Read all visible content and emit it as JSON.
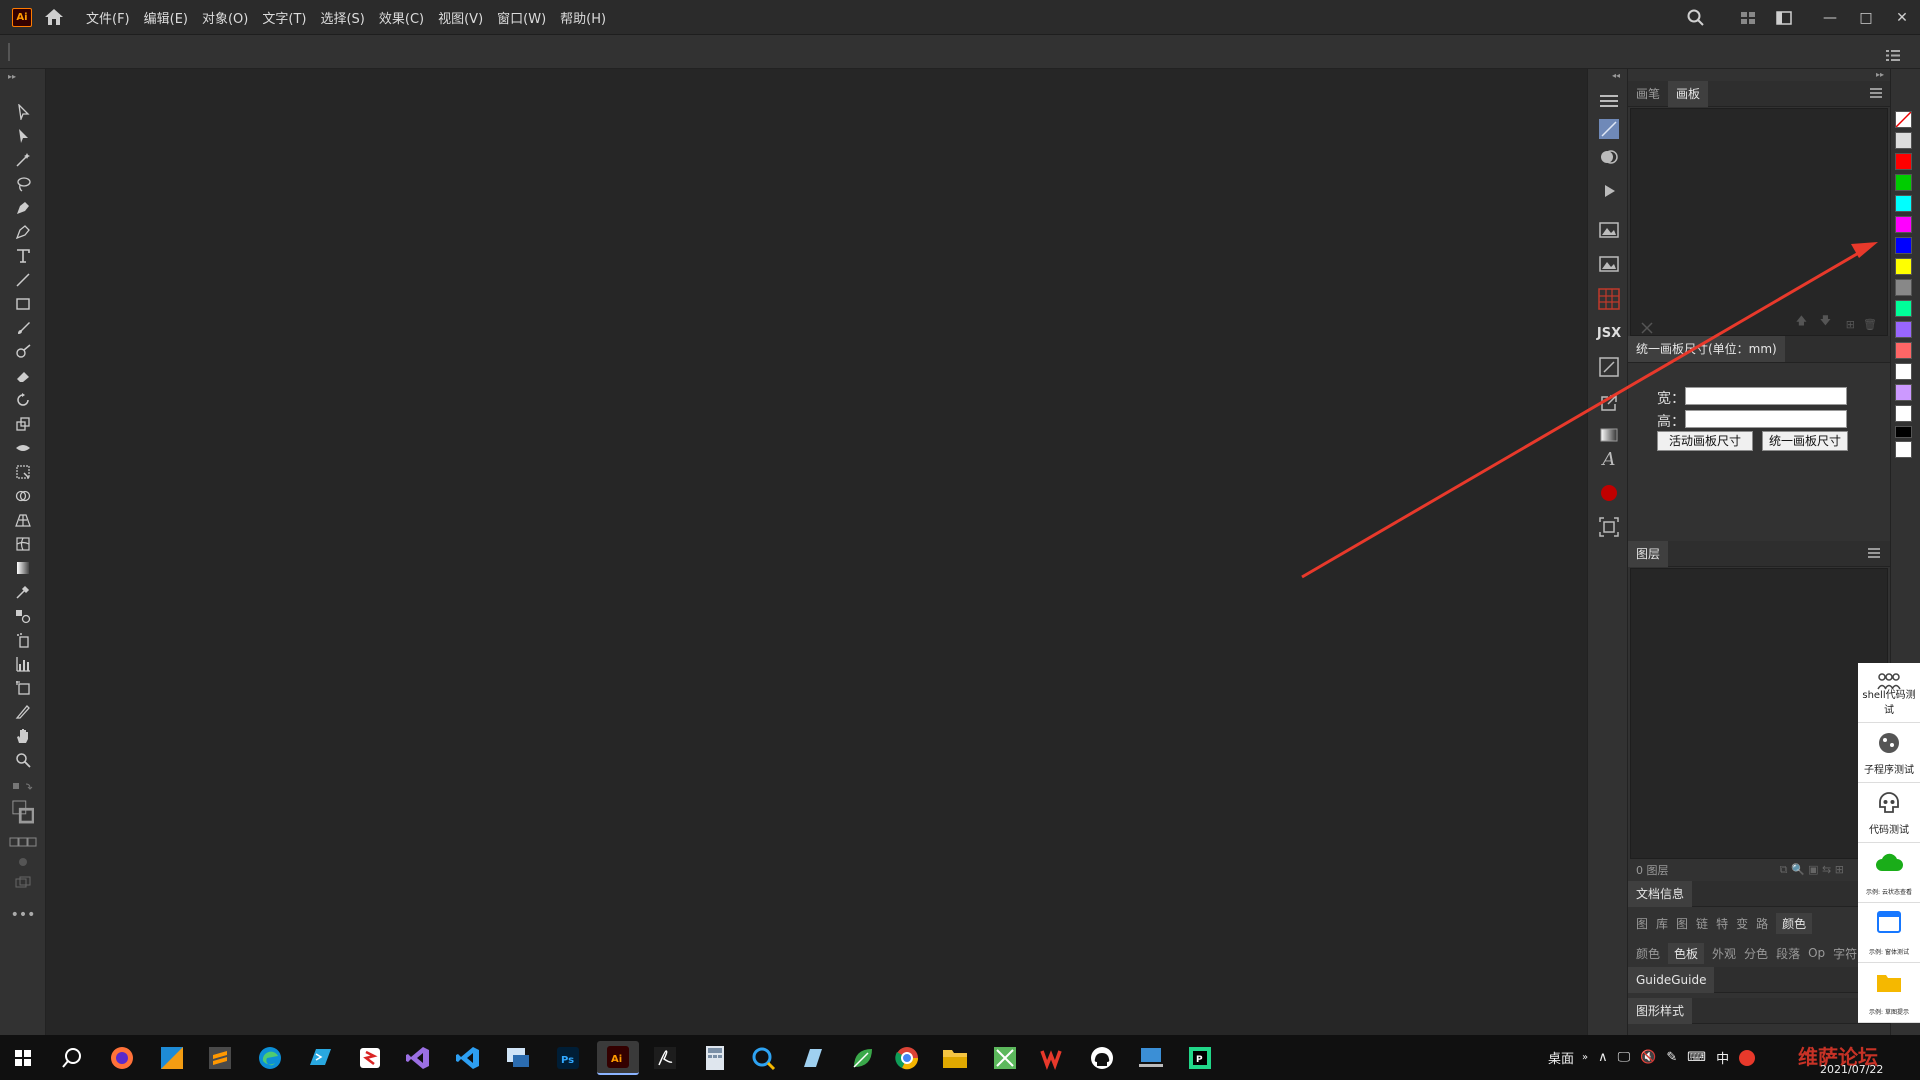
{
  "app": {
    "logo": "Ai",
    "brand_color": "#ff9a00"
  },
  "menu": [
    "文件(F)",
    "编辑(E)",
    "对象(O)",
    "文字(T)",
    "选择(S)",
    "效果(C)",
    "视图(V)",
    "窗口(W)",
    "帮助(H)"
  ],
  "window_controls": {
    "minimize": "—",
    "maximize": "□",
    "close": "✕"
  },
  "dock": {
    "jsx_label": "JSX"
  },
  "artboard_panel": {
    "tabs": [
      "画笔",
      "画板"
    ],
    "active_tab": "画板",
    "unify_title": "统一画板尺寸(单位：mm)",
    "width_label": "宽：",
    "height_label": "高：",
    "width_value": "",
    "height_value": "",
    "active_btn": "活动画板尺寸",
    "unify_btn": "统一画板尺寸"
  },
  "layers_panel": {
    "title": "图层",
    "footer": "0 图层"
  },
  "docinfo": {
    "title": "文档信息"
  },
  "mini_row1": [
    "图",
    "库",
    "图",
    "链",
    "特",
    "变",
    "路"
  ],
  "mini_row1_active": "颜色",
  "mini_row2": [
    "颜色",
    "色板",
    "外观",
    "分色",
    "段落",
    "Op",
    "字符"
  ],
  "mini_row2_active": "色板",
  "guide": {
    "label": "GuideGuide"
  },
  "graphic_styles": {
    "label": "图形样式"
  },
  "side_widgets": [
    "shell代码测试",
    "子程序测试",
    "代码测试",
    "示例: 云状态查看",
    "示例: 窗体测试",
    "示例: 草图提示"
  ],
  "swatch_colors": [
    "#ffffff",
    "#ff0000",
    "#00cc00",
    "#00ffff",
    "#ff00ff",
    "#0000ff",
    "#ffff00",
    "#888888",
    "#00ff99",
    "#9966ff",
    "#ff6666",
    "#ffffff",
    "#cc99ff",
    "#ffffff",
    "#000000",
    "#ffffff"
  ],
  "taskbar": {
    "tray_text": "桌面",
    "ime": "中",
    "date": "2021/07/22",
    "watermark": "维萨论坛"
  }
}
